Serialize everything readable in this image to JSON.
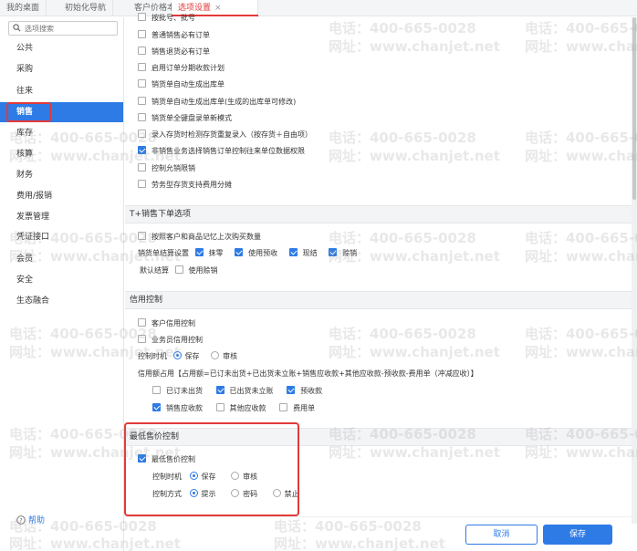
{
  "tabs": [
    {
      "label": "我的桌面"
    },
    {
      "label": "初始化导航"
    },
    {
      "label": "客户价格本"
    },
    {
      "label": "选项设置",
      "close": "×"
    }
  ],
  "sidebar": {
    "search_placeholder": "选项搜索",
    "items": [
      {
        "label": "公共"
      },
      {
        "label": "采购"
      },
      {
        "label": "往来"
      },
      {
        "label": "销售"
      },
      {
        "label": "库存"
      },
      {
        "label": "核算"
      },
      {
        "label": "财务"
      },
      {
        "label": "费用/报销"
      },
      {
        "label": "发票管理"
      },
      {
        "label": "凭证接口"
      },
      {
        "label": "会员"
      },
      {
        "label": "安全"
      },
      {
        "label": "生态融合"
      }
    ],
    "help": "帮助"
  },
  "sales": {
    "options": [
      {
        "label": "按批号、批号",
        "checked": false
      },
      {
        "label": "普通销售必有订单",
        "checked": false
      },
      {
        "label": "销售退货必有订单",
        "checked": false
      },
      {
        "label": "启用订单分期收款计划",
        "checked": false
      },
      {
        "label": "销货单自动生成出库单",
        "checked": false
      },
      {
        "label": "销货单自动生成出库单(生成的出库单可修改)",
        "checked": false
      },
      {
        "label": "销货单全键盘录单新模式",
        "checked": false
      },
      {
        "label": "录入存货时检测存货重复录入（按存货＋自由项）",
        "checked": false
      },
      {
        "label": "非销售业务选择销售订单控制往来单位数据权限",
        "checked": true
      },
      {
        "label": "控制允销限销",
        "checked": false
      },
      {
        "label": "劳务型存货支持费用分摊",
        "checked": false
      }
    ]
  },
  "tplus_order": {
    "title": "T+销售下单选项",
    "remember": {
      "label": "按照客户和商品记忆上次购买数量",
      "checked": false
    },
    "settle_label": "销货单结算设置",
    "settle_opts": [
      {
        "label": "抹零",
        "checked": true
      },
      {
        "label": "使用预收",
        "checked": true
      },
      {
        "label": "现结",
        "checked": true
      },
      {
        "label": "赊销",
        "checked": true
      }
    ],
    "default_settle_label": "默认结算",
    "default_settle_opt": {
      "label": "使用赊销",
      "checked": false
    }
  },
  "credit": {
    "title": "信用控制",
    "customer": {
      "label": "客户信用控制",
      "checked": false
    },
    "salesman": {
      "label": "业务员信用控制",
      "checked": false
    },
    "timing_label": "控制时机",
    "timing_opts": [
      {
        "label": "保存",
        "checked": true
      },
      {
        "label": "审核",
        "checked": false
      }
    ],
    "formula": "信用额占用【占用额=已订未出货+已出货未立账+销售应收款+其他应收款-预收款-费用单（冲减应收）】",
    "items_row1": [
      {
        "label": "已订未出货",
        "checked": false
      },
      {
        "label": "已出货未立账",
        "checked": true
      },
      {
        "label": "预收款",
        "checked": true
      }
    ],
    "items_row2": [
      {
        "label": "销售应收款",
        "checked": true
      },
      {
        "label": "其他应收款",
        "checked": false
      },
      {
        "label": "费用单",
        "checked": false
      }
    ]
  },
  "min_price": {
    "title": "最低售价控制",
    "enable": {
      "label": "最低售价控制",
      "checked": true
    },
    "timing_label": "控制时机",
    "timing_opts": [
      {
        "label": "保存",
        "checked": true
      },
      {
        "label": "审核",
        "checked": false
      }
    ],
    "mode_label": "控制方式",
    "mode_opts": [
      {
        "label": "提示",
        "checked": true
      },
      {
        "label": "密码",
        "checked": false
      },
      {
        "label": "禁止",
        "checked": false
      }
    ]
  },
  "footer": {
    "cancel": "取消",
    "save": "保存"
  },
  "watermark": {
    "phone": "电话：400-665-0028",
    "site": "网址：www.chanjet.net"
  }
}
